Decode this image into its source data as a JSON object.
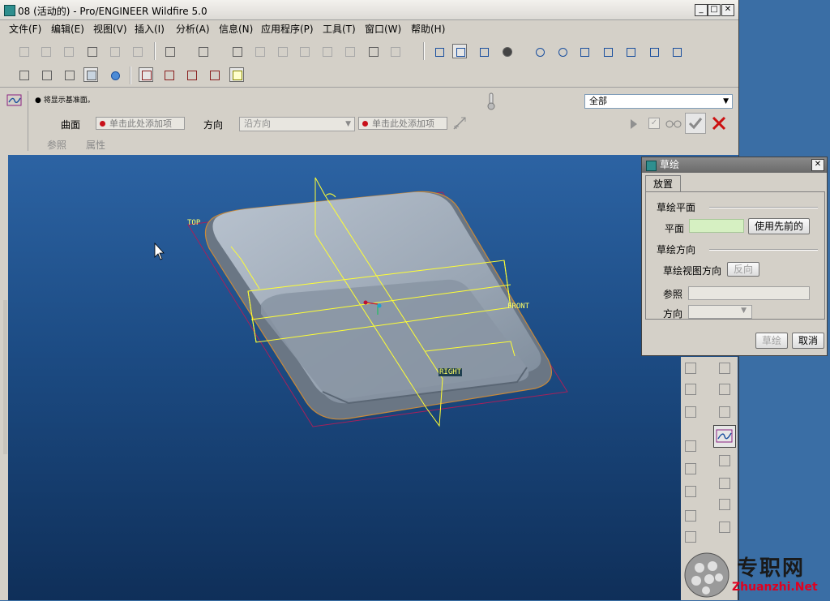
{
  "window": {
    "title": "08 (活动的) - Pro/ENGINEER Wildfire 5.0"
  },
  "menu": [
    "文件(F)",
    "编辑(E)",
    "视图(V)",
    "插入(I)",
    "分析(A)",
    "信息(N)",
    "应用程序(P)",
    "工具(T)",
    "窗口(W)",
    "帮助(H)"
  ],
  "dashboard": {
    "message": "● 将显示基准面。",
    "filter_value": "全部",
    "surface_label": "曲面",
    "surface_collector": "单击此处添加项",
    "direction_label": "方向",
    "direction_value": "沿方向",
    "direction_collector": "单击此处添加项",
    "tabs": [
      "参照",
      "属性"
    ]
  },
  "viewport": {
    "datum_labels": {
      "top": "TOP",
      "front": "FRONT",
      "right": "RIGHT"
    }
  },
  "sketch_dialog": {
    "title": "草绘",
    "tab": "放置",
    "plane_section": "草绘平面",
    "plane_label": "平面",
    "use_previous": "使用先前的",
    "orientation_section": "草绘方向",
    "view_direction_label": "草绘视图方向",
    "flip_button": "反向",
    "reference_label": "参照",
    "orientation_label": "方向",
    "sketch_button": "草绘",
    "cancel_button": "取消"
  },
  "watermark": {
    "brand": "专职网",
    "url": "Zhuanzhi.Net"
  },
  "colors": {
    "viewport_top": "#2c63a3",
    "viewport_bottom": "#0f2f59",
    "plane_field": "#d6f0c2",
    "datum_yellow": "#ffff66",
    "red_x": "#cc1010",
    "accent_green": "#3aa36a"
  }
}
